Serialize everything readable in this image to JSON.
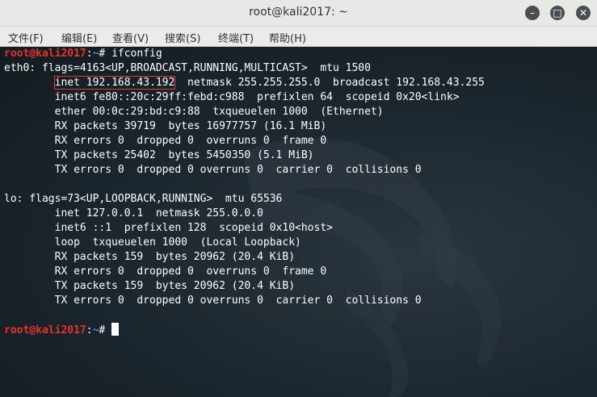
{
  "window": {
    "title": "root@kali2017: ~",
    "buttons": {
      "minimize": "–",
      "maximize": "□",
      "close": "✕"
    }
  },
  "menu": [
    "文件(F)",
    "编辑(E)",
    "查看(V)",
    "搜索(S)",
    "终端(T)",
    "帮助(H)"
  ],
  "prompt": {
    "user_host": "root@kali2017",
    "colon": ":",
    "path": "~",
    "symbol": "# "
  },
  "commands": [
    "ifconfig",
    ""
  ],
  "output": [
    "eth0: flags=4163<UP,BROADCAST,RUNNING,MULTICAST>  mtu 1500",
    "",
    "        inet6 fe80::20c:29ff:febd:c988  prefixlen 64  scopeid 0x20<link>",
    "        ether 00:0c:29:bd:c9:88  txqueuelen 1000  (Ethernet)",
    "        RX packets 39719  bytes 16977757 (16.1 MiB)",
    "        RX errors 0  dropped 0  overruns 0  frame 0",
    "        TX packets 25402  bytes 5450350 (5.1 MiB)",
    "        TX errors 0  dropped 0 overruns 0  carrier 0  collisions 0",
    "",
    "lo: flags=73<UP,LOOPBACK,RUNNING>  mtu 65536",
    "        inet 127.0.0.1  netmask 255.0.0.0",
    "        inet6 ::1  prefixlen 128  scopeid 0x10<host>",
    "        loop  txqueuelen 1000  (Local Loopback)",
    "        RX packets 159  bytes 20962 (20.4 KiB)",
    "        RX errors 0  dropped 0  overruns 0  frame 0",
    "        TX packets 159  bytes 20962 (20.4 KiB)",
    "        TX errors 0  dropped 0 overruns 0  carrier 0  collisions 0",
    ""
  ],
  "eth0_inet": {
    "indent": "        ",
    "highlighted": "inet 192.168.43.192",
    "rest": "  netmask 255.255.255.0  broadcast 192.168.43.255"
  },
  "colors": {
    "prompt_user": "#e6332a",
    "prompt_path": "#4a8ef0",
    "highlight_box": "#e63a2e",
    "terminal_bg": "#1b252d"
  }
}
